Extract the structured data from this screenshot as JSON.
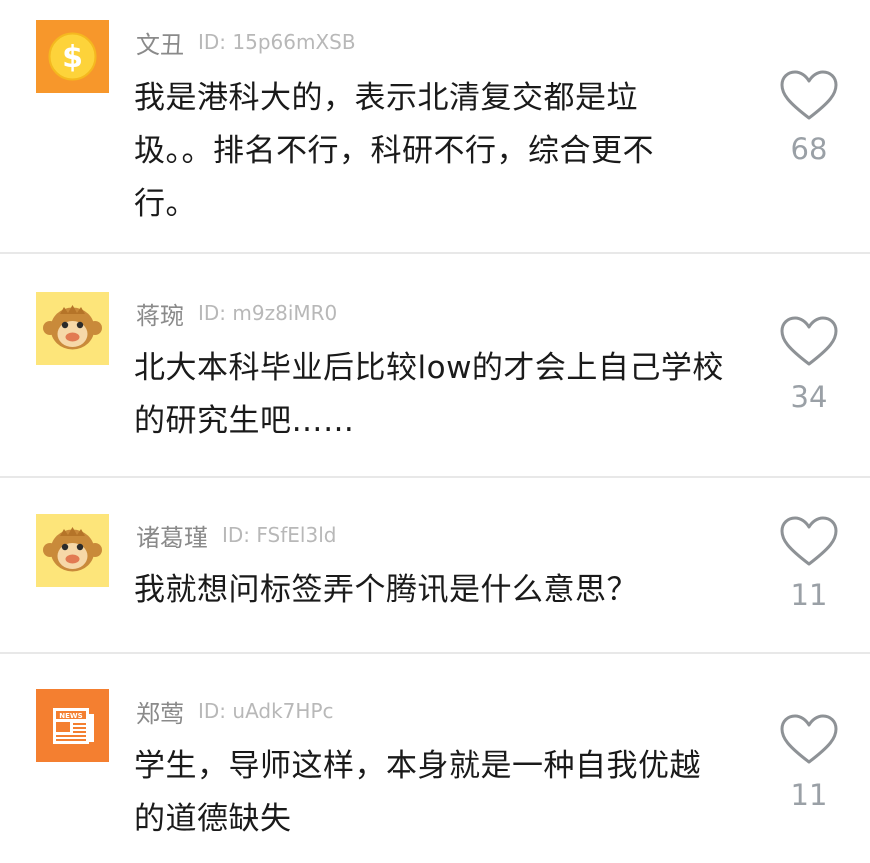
{
  "comments": [
    {
      "avatar_icon": "dollar-coin-icon",
      "name": "文丑",
      "id": "ID: 15p66mXSB",
      "lines": [
        "我是港科大的，表示北清复交都是垃",
        "圾。。排名不行，科研不行，综合更不",
        "行。"
      ],
      "likes": "68"
    },
    {
      "avatar_icon": "monkey-face-icon",
      "name": "蒋琬",
      "id": "ID: m9z8iMR0",
      "lines": [
        "北大本科毕业后比较low的才会上自己学校",
        "的研究生吧……"
      ],
      "likes": "34"
    },
    {
      "avatar_icon": "monkey-face-icon",
      "name": "诸葛瑾",
      "id": "ID: FSfEl3ld",
      "lines": [
        "我就想问标签弄个腾讯是什么意思？"
      ],
      "likes": "11"
    },
    {
      "avatar_icon": "newspaper-icon",
      "name": "郑莺",
      "id": "ID: uAdk7HPc",
      "lines": [
        "学生，导师这样，本身就是一种自我优越",
        "的道德缺失"
      ],
      "likes": "11"
    }
  ],
  "colors": {
    "dollar_avatar_bg": "#f7972b",
    "monkey_avatar_bg": "#fde57a",
    "news_avatar_bg": "#f47f30",
    "name_text": "#8a8a8a",
    "id_text": "#b8b8b8",
    "like_count": "#9aa0a6",
    "divider": "#e8e8e8"
  }
}
